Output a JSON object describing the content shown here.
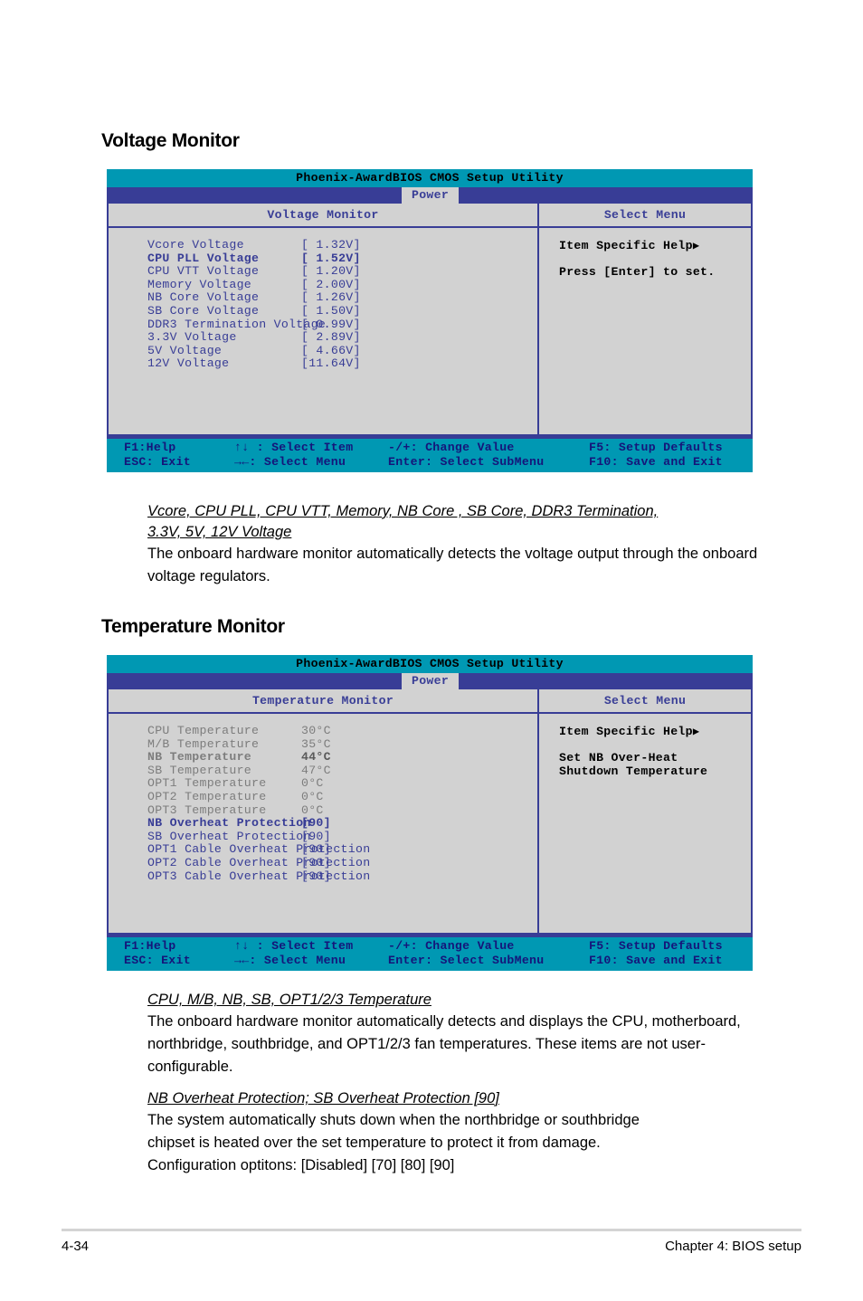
{
  "sections": {
    "voltage": {
      "heading": "Voltage Monitor",
      "bios": {
        "title": "Phoenix-AwardBIOS CMOS Setup Utility",
        "menu_tab": "Power",
        "panel_header": "Voltage Monitor",
        "side_header": "Select Menu",
        "help_title": "Item Specific Help",
        "help_lines": [
          "Press [Enter] to set."
        ],
        "rows": [
          {
            "label": "Vcore Voltage",
            "value": "[ 1.32V]",
            "selected": false
          },
          {
            "label": "CPU PLL Voltage",
            "value": "[ 1.52V]",
            "selected": true
          },
          {
            "label": "CPU VTT Voltage",
            "value": "[ 1.20V]",
            "selected": false
          },
          {
            "label": "Memory Voltage",
            "value": "[ 2.00V]",
            "selected": false
          },
          {
            "label": "NB Core Voltage",
            "value": "[ 1.26V]",
            "selected": false
          },
          {
            "label": "SB Core Voltage",
            "value": "[ 1.50V]",
            "selected": false
          },
          {
            "label": "DDR3 Termination Voltage",
            "value": "[ 0.99V]",
            "selected": false
          },
          {
            "label": "3.3V Voltage",
            "value": "[ 2.89V]",
            "selected": false
          },
          {
            "label": "5V Voltage",
            "value": "[ 4.66V]",
            "selected": false
          },
          {
            "label": "12V Voltage",
            "value": "[11.64V]",
            "selected": false
          }
        ]
      },
      "description": {
        "sub_heading_line1": "Vcore, CPU PLL, CPU VTT, Memory, NB Core , SB Core, DDR3 Termination,",
        "sub_heading_line2": "3.3V, 5V, 12V Voltage",
        "paragraph": "The onboard hardware monitor automatically detects the voltage output through the onboard voltage regulators."
      }
    },
    "temperature": {
      "heading": "Temperature Monitor",
      "bios": {
        "title": "Phoenix-AwardBIOS CMOS Setup Utility",
        "menu_tab": "Power",
        "panel_header": "Temperature Monitor",
        "side_header": "Select Menu",
        "help_title": "Item Specific Help",
        "help_lines": [
          "Set NB Over-Heat",
          "Shutdown Temperature"
        ],
        "rows": [
          {
            "label": "CPU Temperature",
            "value": "30°C",
            "dim": true,
            "selected": false
          },
          {
            "label": "M/B Temperature",
            "value": "35°C",
            "dim": true,
            "selected": false
          },
          {
            "label": "NB Temperature",
            "value": "44°C",
            "dim": true,
            "selected": true
          },
          {
            "label": "SB Temperature",
            "value": "47°C",
            "dim": true,
            "selected": false
          },
          {
            "label": "OPT1 Temperature",
            "value": "0°C",
            "dim": true,
            "selected": false
          },
          {
            "label": "OPT2 Temperature",
            "value": "0°C",
            "dim": true,
            "selected": false
          },
          {
            "label": "OPT3 Temperature",
            "value": "0°C",
            "dim": true,
            "selected": false
          },
          {
            "label": "NB Overheat Protection",
            "value": "[90]",
            "dim": false,
            "selected": true
          },
          {
            "label": "SB Overheat Protection",
            "value": "[90]",
            "dim": false,
            "selected": false
          },
          {
            "label": "OPT1 Cable Overheat Protection",
            "value": "[90]",
            "dim": false,
            "selected": false
          },
          {
            "label": "OPT2 Cable Overheat Protection",
            "value": "[90]",
            "dim": false,
            "selected": false
          },
          {
            "label": "OPT3 Cable Overheat Protection",
            "value": "[90]",
            "dim": false,
            "selected": false
          }
        ]
      },
      "description_temps": {
        "sub_heading": "CPU, M/B, NB, SB, OPT1/2/3 Temperature",
        "paragraph": "The onboard hardware monitor automatically detects and displays the CPU, motherboard, northbridge, southbridge, and OPT1/2/3 fan temperatures. These items are not user-configurable."
      },
      "description_overheat": {
        "sub_heading": "NB Overheat Protection; SB Overheat Protection [90]",
        "paragraph_line1": "The system automatically shuts down when the northbridge or southbridge",
        "paragraph_line2": "chipset is heated over the set temperature to protect it from damage.",
        "paragraph_line3": "Configuration optitons: [Disabled] [70] [80] [90]"
      }
    }
  },
  "keybar": {
    "row1": {
      "help": "F1:Help",
      "select_item": "↑↓ : Select Item",
      "change_value": "-/+: Change Value",
      "setup_defaults": "F5: Setup Defaults"
    },
    "row2": {
      "exit": "ESC: Exit",
      "select_menu": "→←: Select Menu",
      "select_submenu": "Enter: Select SubMenu",
      "save_exit": "F10: Save and Exit"
    }
  },
  "page_footer": {
    "page_number": "4-34",
    "chapter": "Chapter 4: BIOS setup"
  },
  "colors": {
    "titlebar": "#0098b3",
    "menubar": "#383d96",
    "panel_bg": "#d2d2d2",
    "text_navy": "#383d96",
    "text_dim": "#7d7d7d",
    "keybar_text": "#15157a"
  }
}
